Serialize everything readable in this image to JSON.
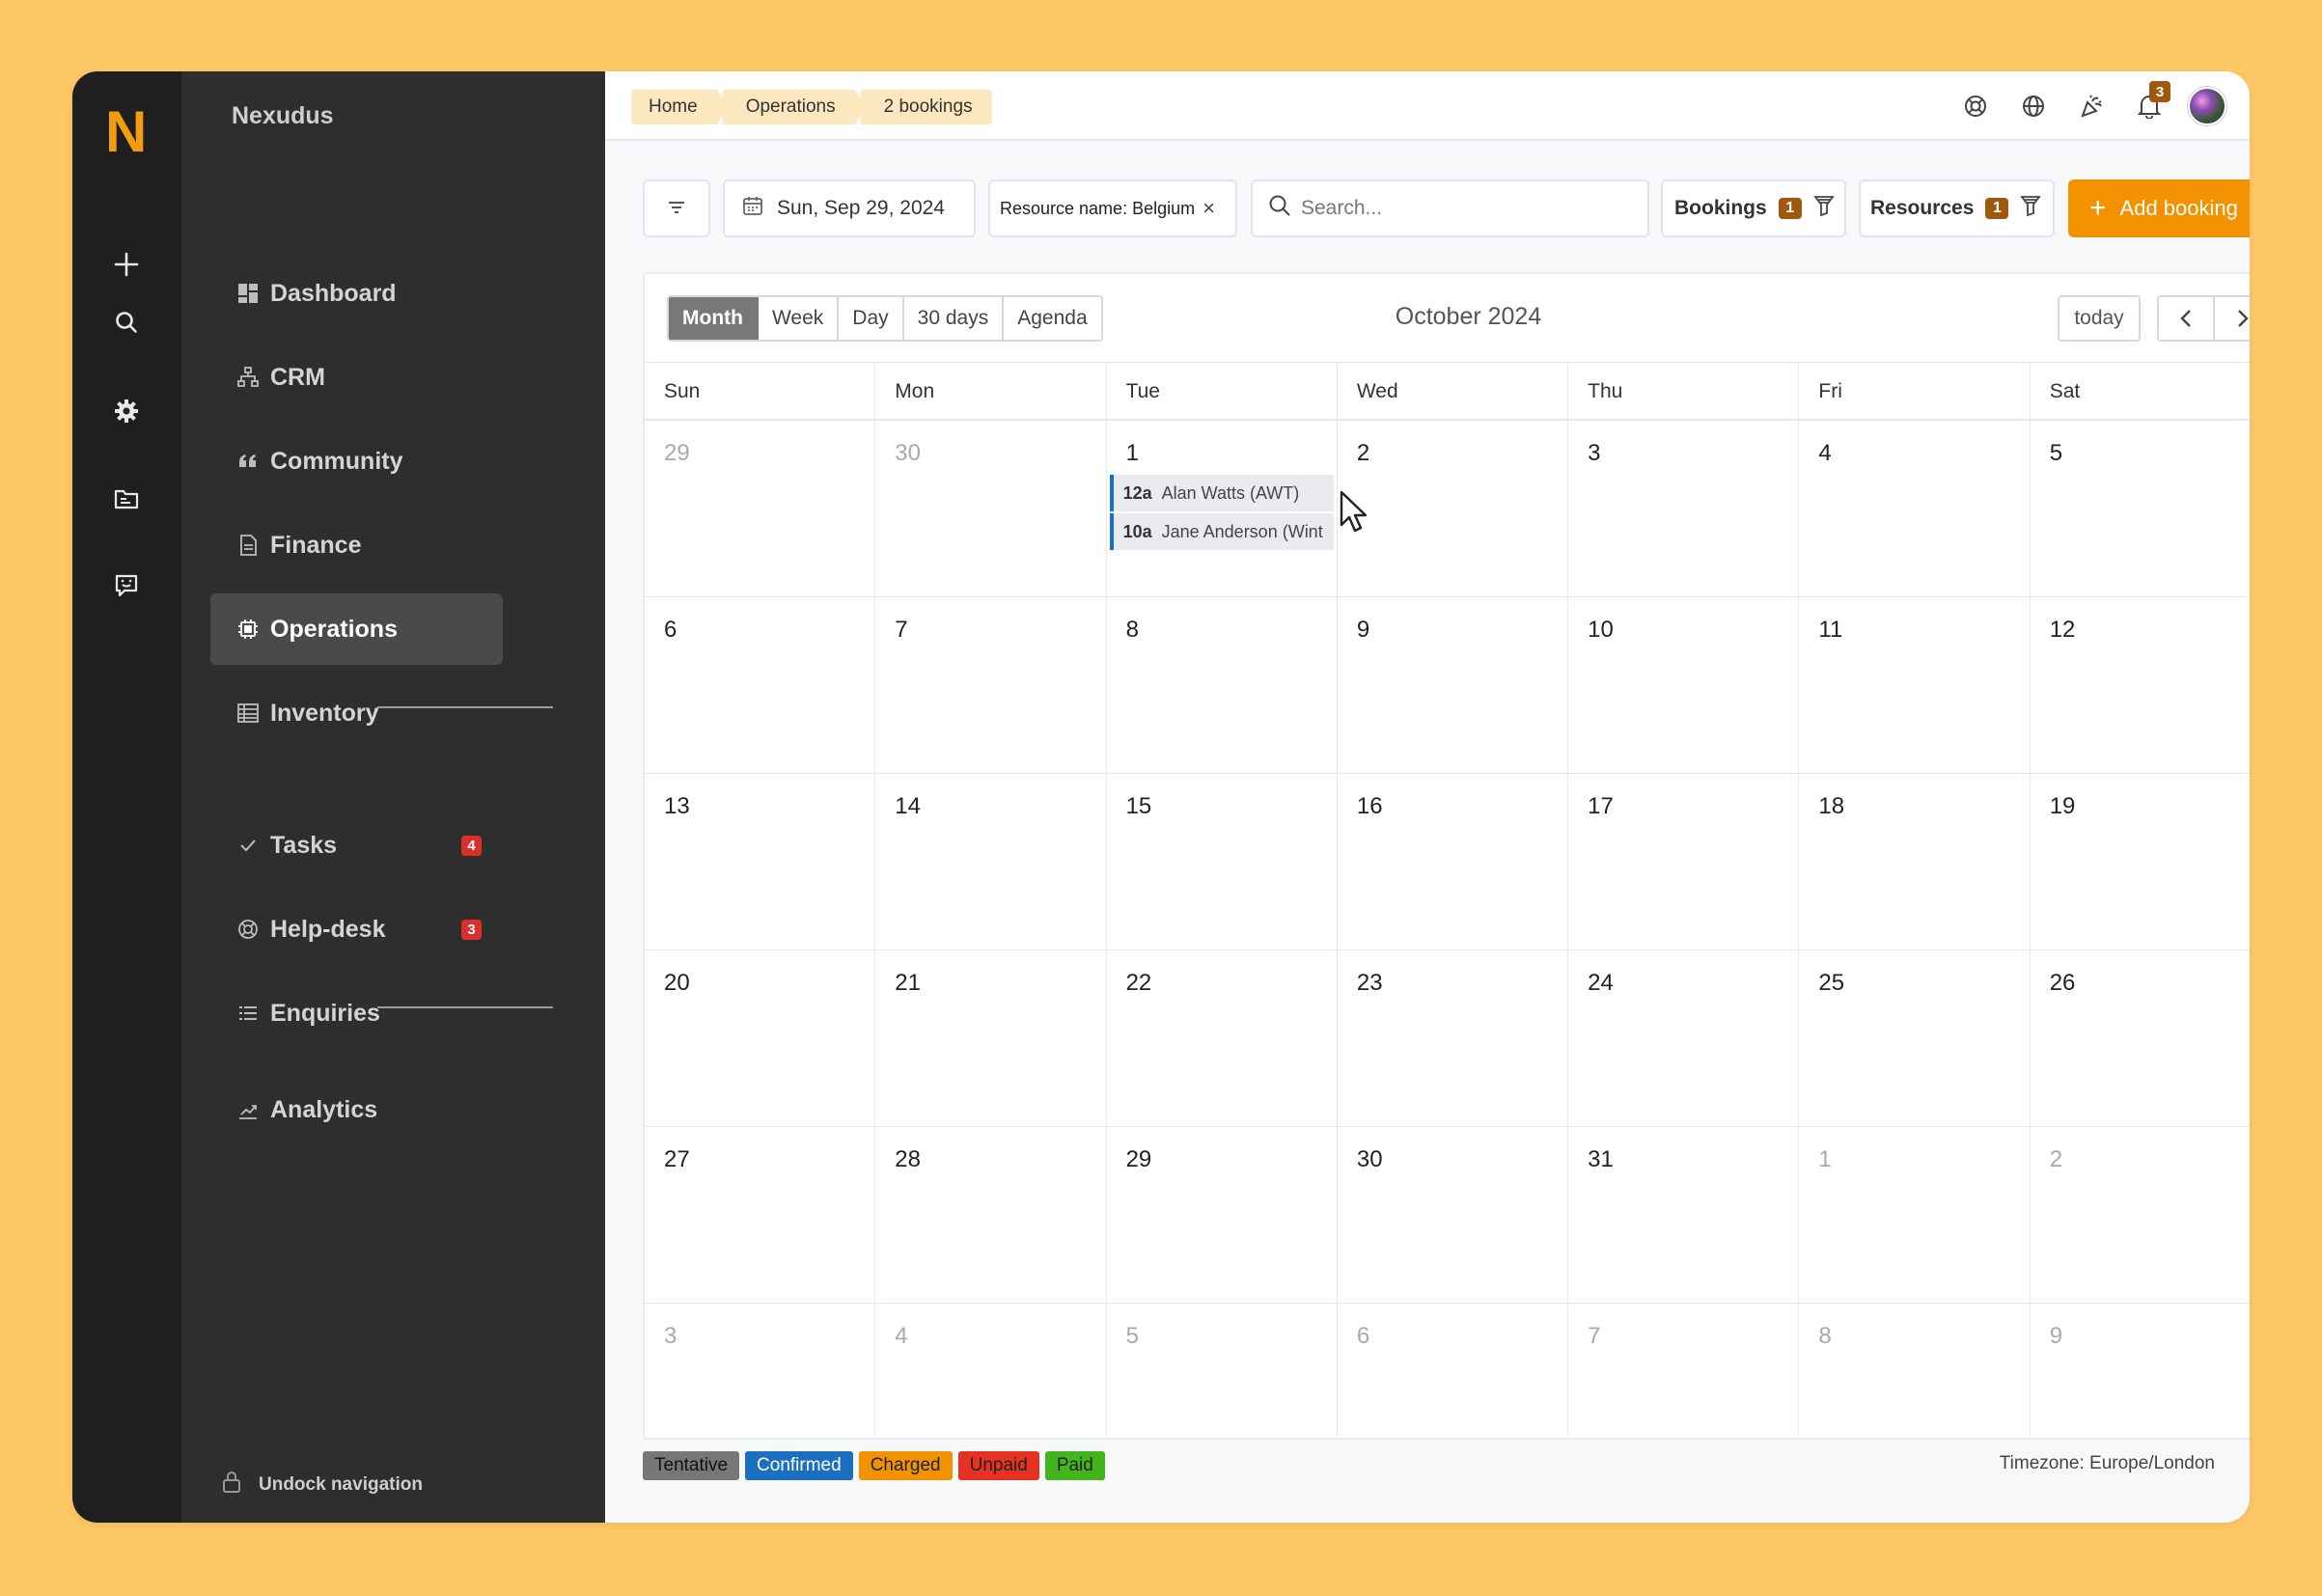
{
  "rail": {
    "logo": "N",
    "icons": [
      "plus-icon",
      "search-icon",
      "gear-icon",
      "folder-icon",
      "feedback-icon"
    ]
  },
  "sidebar": {
    "brand": "Nexudus",
    "items": [
      {
        "label": "Dashboard",
        "icon": "dashboard-icon"
      },
      {
        "label": "CRM",
        "icon": "org-chart-icon"
      },
      {
        "label": "Community",
        "icon": "quote-icon"
      },
      {
        "label": "Finance",
        "icon": "document-icon"
      },
      {
        "label": "Operations",
        "icon": "chip-icon",
        "active": true
      },
      {
        "label": "Inventory",
        "icon": "table-icon"
      },
      {
        "label": "Tasks",
        "icon": "check-icon",
        "badge": "4"
      },
      {
        "label": "Help-desk",
        "icon": "lifebuoy-icon",
        "badge": "3"
      },
      {
        "label": "Enquiries",
        "icon": "list-icon"
      },
      {
        "label": "Analytics",
        "icon": "chart-icon"
      }
    ],
    "undock": "Undock navigation"
  },
  "topbar": {
    "breadcrumbs": [
      "Home",
      "Operations",
      "2 bookings"
    ],
    "notification_count": "3"
  },
  "toolbar": {
    "date": "Sun, Sep 29, 2024",
    "filter_chip": "Resource name: Belgium",
    "search_placeholder": "Search...",
    "bookings_label": "Bookings",
    "bookings_count": "1",
    "resources_label": "Resources",
    "resources_count": "1",
    "add_label": "Add booking"
  },
  "calendar": {
    "views": [
      "Month",
      "Week",
      "Day",
      "30 days",
      "Agenda"
    ],
    "active_view": "Month",
    "title": "October 2024",
    "today_label": "today",
    "weekdays": [
      "Sun",
      "Mon",
      "Tue",
      "Wed",
      "Thu",
      "Fri",
      "Sat"
    ],
    "weeks": [
      [
        {
          "d": "29",
          "o": true
        },
        {
          "d": "30",
          "o": true
        },
        {
          "d": "1"
        },
        {
          "d": "2"
        },
        {
          "d": "3"
        },
        {
          "d": "4"
        },
        {
          "d": "5"
        }
      ],
      [
        {
          "d": "6"
        },
        {
          "d": "7"
        },
        {
          "d": "8"
        },
        {
          "d": "9"
        },
        {
          "d": "10"
        },
        {
          "d": "11"
        },
        {
          "d": "12"
        }
      ],
      [
        {
          "d": "13"
        },
        {
          "d": "14"
        },
        {
          "d": "15"
        },
        {
          "d": "16"
        },
        {
          "d": "17"
        },
        {
          "d": "18"
        },
        {
          "d": "19"
        }
      ],
      [
        {
          "d": "20"
        },
        {
          "d": "21"
        },
        {
          "d": "22"
        },
        {
          "d": "23"
        },
        {
          "d": "24"
        },
        {
          "d": "25"
        },
        {
          "d": "26"
        }
      ],
      [
        {
          "d": "27"
        },
        {
          "d": "28"
        },
        {
          "d": "29"
        },
        {
          "d": "30"
        },
        {
          "d": "31"
        },
        {
          "d": "1",
          "o": true
        },
        {
          "d": "2",
          "o": true
        }
      ],
      [
        {
          "d": "3",
          "o": true
        },
        {
          "d": "4",
          "o": true
        },
        {
          "d": "5",
          "o": true
        },
        {
          "d": "6",
          "o": true
        },
        {
          "d": "7",
          "o": true
        },
        {
          "d": "8",
          "o": true
        },
        {
          "d": "9",
          "o": true
        }
      ]
    ],
    "events": [
      {
        "week": 0,
        "day": 2,
        "time": "12a",
        "title": "Alan Watts (AWT)"
      },
      {
        "week": 0,
        "day": 2,
        "time": "10a",
        "title": "Jane Anderson (Wint"
      }
    ]
  },
  "legend": [
    {
      "label": "Tentative",
      "bg": "#777777",
      "fg": "#111111"
    },
    {
      "label": "Confirmed",
      "bg": "#1b6fc0",
      "fg": "#ffffff"
    },
    {
      "label": "Charged",
      "bg": "#F39200",
      "fg": "#222222"
    },
    {
      "label": "Unpaid",
      "bg": "#e53222",
      "fg": "#222222"
    },
    {
      "label": "Paid",
      "bg": "#43b51c",
      "fg": "#222222"
    }
  ],
  "timezone": "Timezone: Europe/London",
  "colors": {
    "accent": "#F39200",
    "badge_brown": "#A0570E",
    "event_blue": "#1b6fc0"
  }
}
